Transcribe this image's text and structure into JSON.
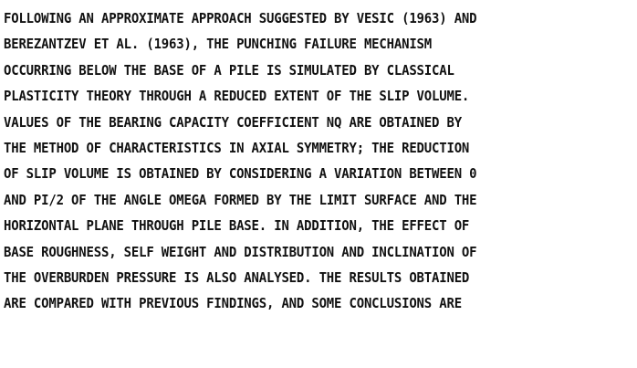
{
  "document": {
    "lines": [
      "FOLLOWING AN APPROXIMATE APPROACH SUGGESTED BY VESIC (1963) AND",
      "BEREZANTZEV ET AL. (1963), THE PUNCHING FAILURE MECHANISM",
      "OCCURRING BELOW THE BASE OF A PILE IS SIMULATED BY CLASSICAL",
      "PLASTICITY THEORY THROUGH A REDUCED EXTENT OF THE SLIP VOLUME.",
      "VALUES OF THE BEARING CAPACITY COEFFICIENT NQ ARE OBTAINED BY",
      "THE METHOD OF CHARACTERISTICS IN AXIAL SYMMETRY; THE REDUCTION",
      "OF SLIP VOLUME IS OBTAINED BY CONSIDERING A VARIATION BETWEEN 0",
      "AND PI/2 OF THE ANGLE OMEGA FORMED BY THE LIMIT SURFACE AND THE",
      "HORIZONTAL PLANE THROUGH PILE BASE. IN ADDITION, THE EFFECT OF",
      "BASE ROUGHNESS, SELF WEIGHT AND DISTRIBUTION AND INCLINATION OF",
      "THE OVERBURDEN PRESSURE IS ALSO ANALYSED. THE RESULTS OBTAINED",
      "ARE COMPARED WITH PREVIOUS FINDINGS, AND SOME CONCLUSIONS ARE"
    ]
  }
}
